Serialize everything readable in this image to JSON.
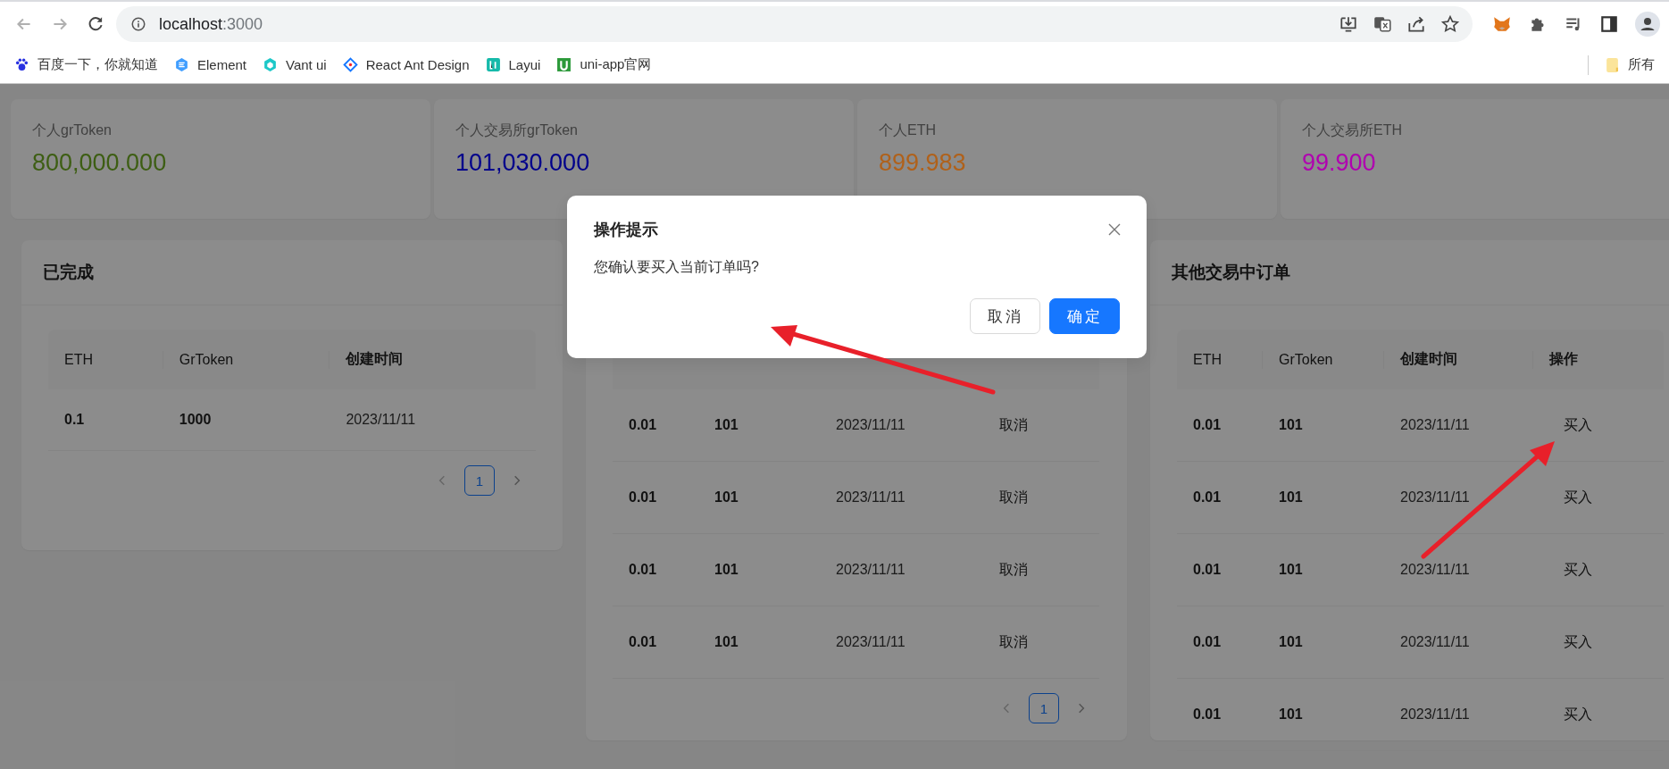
{
  "browser": {
    "url_host": "localhost",
    "url_port": ":3000",
    "bookmarks": [
      {
        "label": "百度一下，你就知道",
        "kind": "paw"
      },
      {
        "label": "Element",
        "kind": "hex"
      },
      {
        "label": "Vant ui",
        "kind": "cube"
      },
      {
        "label": "React Ant Design",
        "kind": "diamond"
      },
      {
        "label": "Layui",
        "kind": "teal"
      },
      {
        "label": "uni-app官网",
        "kind": "green"
      }
    ],
    "other_bookmarks": "所有"
  },
  "stats": [
    {
      "label": "个人grToken",
      "value": "800,000.000",
      "color": "#3d5e13"
    },
    {
      "label": "个人交易所grToken",
      "value": "101,030.000",
      "color": "#00008b"
    },
    {
      "label": "个人ETH",
      "value": "899.983",
      "color": "#b0611a"
    },
    {
      "label": "个人交易所ETH",
      "value": "99.900",
      "color": "#b000b0"
    }
  ],
  "panels": [
    {
      "title": "已完成",
      "columns": [
        "ETH",
        "GrToken",
        "创建时间"
      ],
      "rows": [
        [
          "0.1",
          "1000",
          "2023/11/11"
        ]
      ],
      "pages": [
        {
          "label": "1",
          "selected": true
        }
      ]
    },
    {
      "rows": [
        [
          "0.01",
          "101",
          "2023/11/11",
          "取消"
        ],
        [
          "0.01",
          "101",
          "2023/11/11",
          "取消"
        ],
        [
          "0.01",
          "101",
          "2023/11/11",
          "取消"
        ],
        [
          "0.01",
          "101",
          "2023/11/11",
          "取消"
        ]
      ],
      "pages": [
        {
          "label": "1",
          "selected": true
        }
      ]
    },
    {
      "title": "其他交易中订单",
      "columns": [
        "ETH",
        "GrToken",
        "创建时间",
        "操作"
      ],
      "rows": [
        [
          "0.01",
          "101",
          "2023/11/11",
          "买入"
        ],
        [
          "0.01",
          "101",
          "2023/11/11",
          "买入"
        ],
        [
          "0.01",
          "101",
          "2023/11/11",
          "买入"
        ],
        [
          "0.01",
          "101",
          "2023/11/11",
          "买入"
        ],
        [
          "0.01",
          "101",
          "2023/11/11",
          "买入"
        ]
      ]
    }
  ],
  "dialog": {
    "title": "操作提示",
    "message": "您确认要买入当前订单吗?",
    "buttons": [
      {
        "label": "取消",
        "kind": "default"
      },
      {
        "label": "确定",
        "kind": "primary"
      }
    ]
  }
}
